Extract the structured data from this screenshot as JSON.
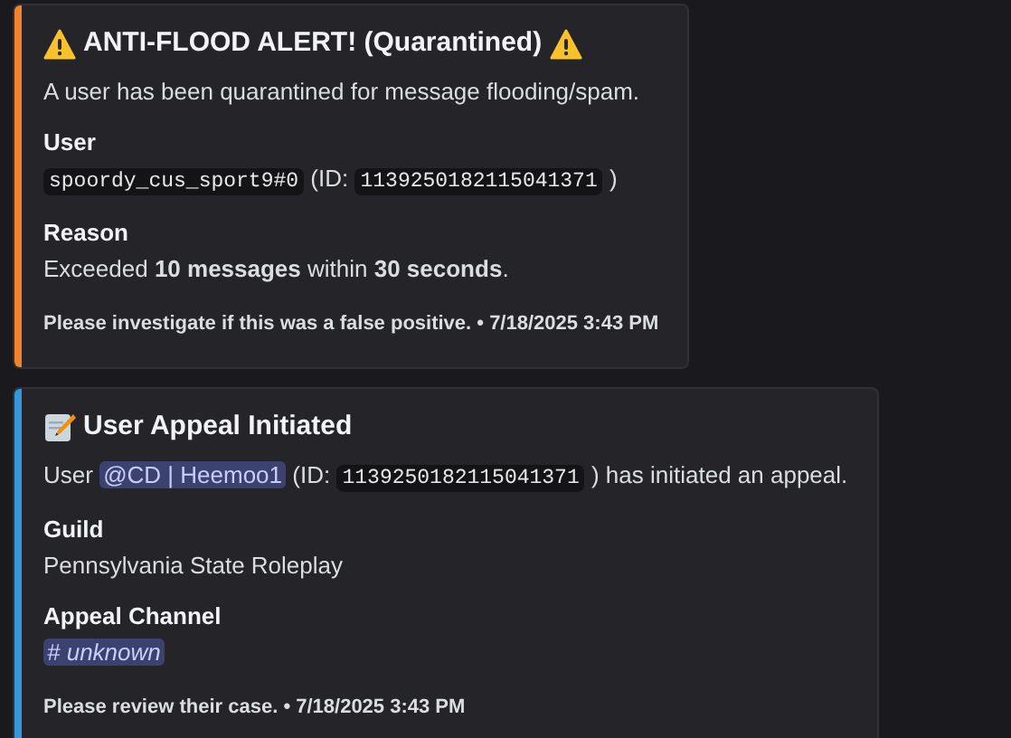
{
  "embeds": [
    {
      "color": "#f0832b",
      "title": [
        {
          "kind": "warning"
        },
        {
          "kind": "text",
          "text": "ANTI-FLOOD ALERT! (Quarantined)"
        },
        {
          "kind": "warning"
        }
      ],
      "description": [
        {
          "kind": "text",
          "text": "A user has been quarantined for message flooding/spam."
        }
      ],
      "fields": [
        {
          "name": "User",
          "value": [
            {
              "kind": "code",
              "text": "spoordy_cus_sport9#0"
            },
            {
              "kind": "text",
              "text": "(ID:"
            },
            {
              "kind": "code",
              "text": "1139250182115041371"
            },
            {
              "kind": "text",
              "text": ")"
            }
          ]
        },
        {
          "name": "Reason",
          "value": [
            {
              "kind": "text",
              "text": "Exceeded **10 messages** within **30 seconds**."
            }
          ]
        }
      ],
      "footer": "Please investigate if this was a false positive. • 7/18/2025 3:43 PM"
    },
    {
      "color": "#3498db",
      "title": [
        {
          "kind": "memo"
        },
        {
          "kind": "text",
          "text": "User Appeal Initiated"
        }
      ],
      "description": [
        {
          "kind": "text",
          "text": "User"
        },
        {
          "kind": "mention",
          "text": "@CD | Heemoo1"
        },
        {
          "kind": "text",
          "text": "(ID:"
        },
        {
          "kind": "code",
          "text": "1139250182115041371"
        },
        {
          "kind": "text",
          "text": ") has initiated an appeal."
        }
      ],
      "fields": [
        {
          "name": "Guild",
          "value": [
            {
              "kind": "text",
              "text": "Pennsylvania State Roleplay"
            }
          ]
        },
        {
          "name": "Appeal Channel",
          "value": [
            {
              "kind": "channel",
              "text": "# unknown"
            }
          ]
        }
      ],
      "footer": "Please review their case. • 7/18/2025 3:43 PM"
    }
  ]
}
